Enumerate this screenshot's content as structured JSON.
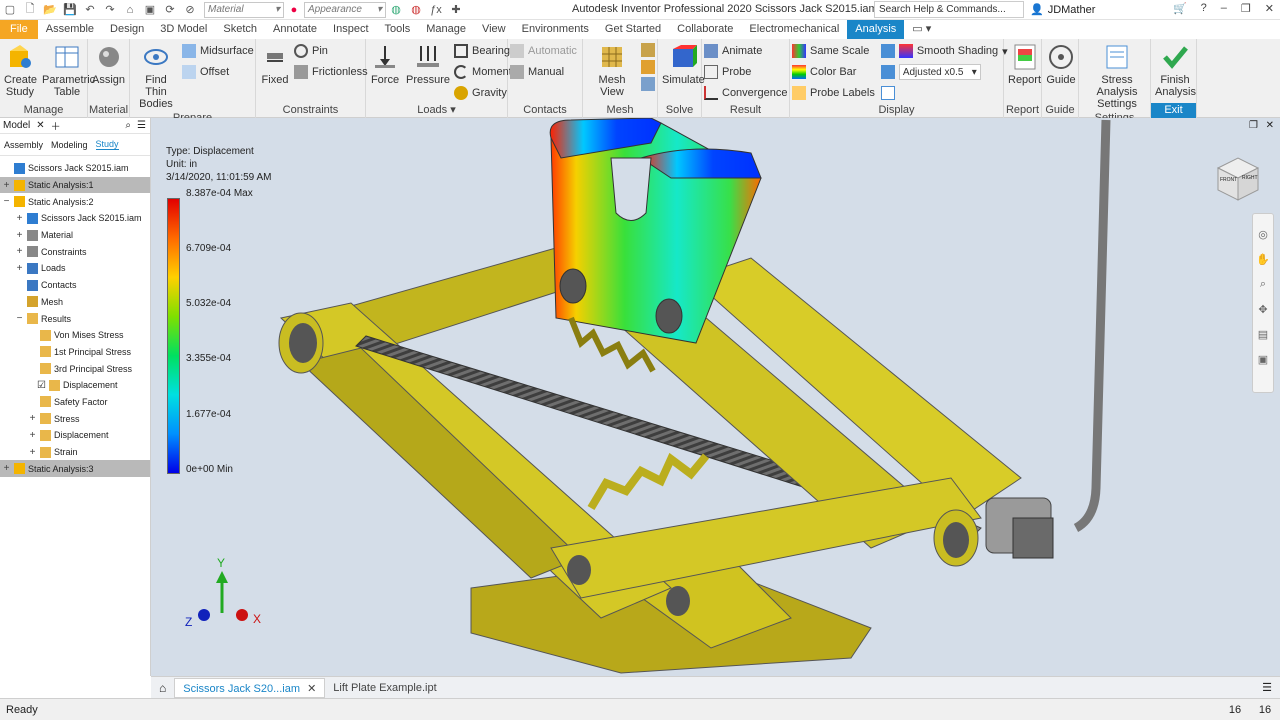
{
  "qat": {
    "material": "Material",
    "appearance": "Appearance"
  },
  "window": {
    "title": "Autodesk Inventor Professional 2020   Scissors Jack S2015.iam",
    "search_placeholder": "Search Help & Commands...",
    "user": "JDMather"
  },
  "tabs": [
    "File",
    "Assemble",
    "Design",
    "3D Model",
    "Sketch",
    "Annotate",
    "Inspect",
    "Tools",
    "Manage",
    "View",
    "Environments",
    "Get Started",
    "Collaborate",
    "Electromechanical",
    "Analysis"
  ],
  "active_tab": "Analysis",
  "ribbon": {
    "manage": {
      "title": "Manage",
      "create_study": "Create Study",
      "parametric_table": "Parametric Table"
    },
    "material": {
      "title": "Material",
      "assign": "Assign"
    },
    "prepare": {
      "title": "Prepare",
      "find_thin_bodies": "Find Thin Bodies",
      "midsurface": "Midsurface",
      "offset": "Offset"
    },
    "constraints": {
      "title": "Constraints",
      "fixed": "Fixed",
      "pin": "Pin",
      "frictionless": "Frictionless"
    },
    "loads": {
      "title": "Loads",
      "force": "Force",
      "pressure": "Pressure",
      "bearing": "Bearing",
      "moment": "Moment",
      "gravity": "Gravity"
    },
    "contacts": {
      "title": "Contacts",
      "automatic": "Automatic",
      "manual": "Manual"
    },
    "mesh": {
      "title": "Mesh",
      "mesh_view": "Mesh View"
    },
    "solve": {
      "title": "Solve",
      "simulate": "Simulate"
    },
    "result": {
      "title": "Result",
      "animate": "Animate",
      "probe": "Probe",
      "convergence": "Convergence"
    },
    "display": {
      "title": "Display",
      "same_scale": "Same Scale",
      "color_bar": "Color Bar",
      "probe_labels": "Probe Labels",
      "smooth_shading": "Smooth Shading",
      "adjusted": "Adjusted x0.5"
    },
    "report": {
      "title": "Report",
      "report": "Report"
    },
    "guide": {
      "title": "Guide",
      "guide": "Guide"
    },
    "settings": {
      "title": "Settings",
      "stress_analysis_settings": "Stress Analysis Settings"
    },
    "exit": {
      "title": "Exit",
      "finish_analysis": "Finish Analysis"
    }
  },
  "browser": {
    "title": "Model",
    "tabs": [
      "Assembly",
      "Modeling",
      "Study"
    ],
    "tree": [
      {
        "label": "Scissors Jack S2015.iam",
        "level": 0,
        "exp": "",
        "sel": false
      },
      {
        "label": "Static Analysis:1",
        "level": 0,
        "exp": "+",
        "sel": true
      },
      {
        "label": "Static Analysis:2",
        "level": 0,
        "exp": "−",
        "sel": false
      },
      {
        "label": "Scissors Jack S2015.iam",
        "level": 1,
        "exp": "+",
        "sel": false
      },
      {
        "label": "Material",
        "level": 1,
        "exp": "+",
        "sel": false
      },
      {
        "label": "Constraints",
        "level": 1,
        "exp": "+",
        "sel": false
      },
      {
        "label": "Loads",
        "level": 1,
        "exp": "+",
        "sel": false
      },
      {
        "label": "Contacts",
        "level": 1,
        "exp": "",
        "sel": false
      },
      {
        "label": "Mesh",
        "level": 1,
        "exp": "",
        "sel": false
      },
      {
        "label": "Results",
        "level": 1,
        "exp": "−",
        "sel": false
      },
      {
        "label": "Von Mises Stress",
        "level": 2,
        "exp": "",
        "sel": false
      },
      {
        "label": "1st Principal Stress",
        "level": 2,
        "exp": "",
        "sel": false
      },
      {
        "label": "3rd Principal Stress",
        "level": 2,
        "exp": "",
        "sel": false
      },
      {
        "label": "Displacement",
        "level": 2,
        "exp": "",
        "sel": false,
        "check": true
      },
      {
        "label": "Safety Factor",
        "level": 2,
        "exp": "",
        "sel": false
      },
      {
        "label": "Stress",
        "level": 2,
        "exp": "+",
        "sel": false
      },
      {
        "label": "Displacement",
        "level": 2,
        "exp": "+",
        "sel": false
      },
      {
        "label": "Strain",
        "level": 2,
        "exp": "+",
        "sel": false
      },
      {
        "label": "Static Analysis:3",
        "level": 0,
        "exp": "+",
        "sel": true
      }
    ]
  },
  "legend": {
    "type": "Type: Displacement",
    "unit": "Unit: in",
    "date": "3/14/2020, 11:01:59 AM",
    "ticks": [
      "8.387e-04 Max",
      "6.709e-04",
      "5.032e-04",
      "3.355e-04",
      "1.677e-04",
      "0e+00 Min"
    ]
  },
  "viewcube": {
    "front": "FRONT",
    "right": "RIGHT"
  },
  "triad": {
    "x": "X",
    "y": "Y",
    "z": "Z"
  },
  "doc_tabs": [
    "Scissors Jack S20...iam",
    "Lift Plate Example.ipt"
  ],
  "status": {
    "text": "Ready",
    "num1": "16",
    "num2": "16"
  }
}
